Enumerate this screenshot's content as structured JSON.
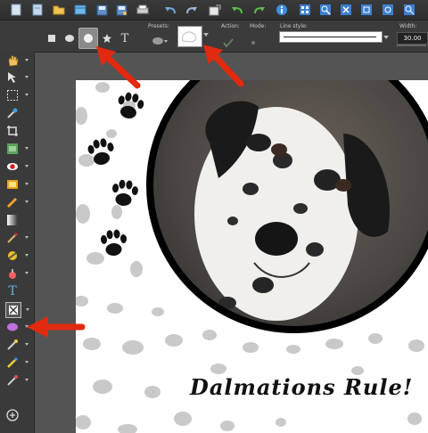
{
  "option_bar": {
    "presets_label": "Presets:",
    "action_label": "Action:",
    "mode_label": "Mode:",
    "line_style_label": "Line style:",
    "width_label": "Width:",
    "width_value": "30.00",
    "text_tool_glyph": "T"
  },
  "toolbar_icons": [
    "new-document-icon",
    "new-from-template-icon",
    "open-folder-icon",
    "browse-icon",
    "save-icon",
    "save-as-icon",
    "print-icon",
    "image-cut-icon",
    "undo-icon",
    "redo-icon",
    "info-icon",
    "zoom-grid-icon",
    "zoom-in-icon",
    "zoom-out-icon",
    "fit-icon",
    "actual-size-icon"
  ],
  "left_tools": [
    "pan-tool",
    "pick-tool",
    "selection-tool",
    "dropper-tool",
    "crop-tool",
    "straighten-tool",
    "red-eye-tool",
    "makeover-tool",
    "clone-tool",
    "scratch-remover-tool",
    "gradient-tool",
    "paint-brush-tool",
    "lighten-darken-tool",
    "fill-tool",
    "text-tool",
    "preset-shape-tool",
    "ellipse-tool",
    "dodge-tool",
    "color-replacer-tool",
    "eraser-tool",
    "add-tool"
  ],
  "canvas": {
    "caption": "Dalmations Rule!"
  },
  "colors": {
    "arrow": "#e12a10",
    "ui_dark": "#3a3a3a",
    "workspace": "#545454"
  }
}
